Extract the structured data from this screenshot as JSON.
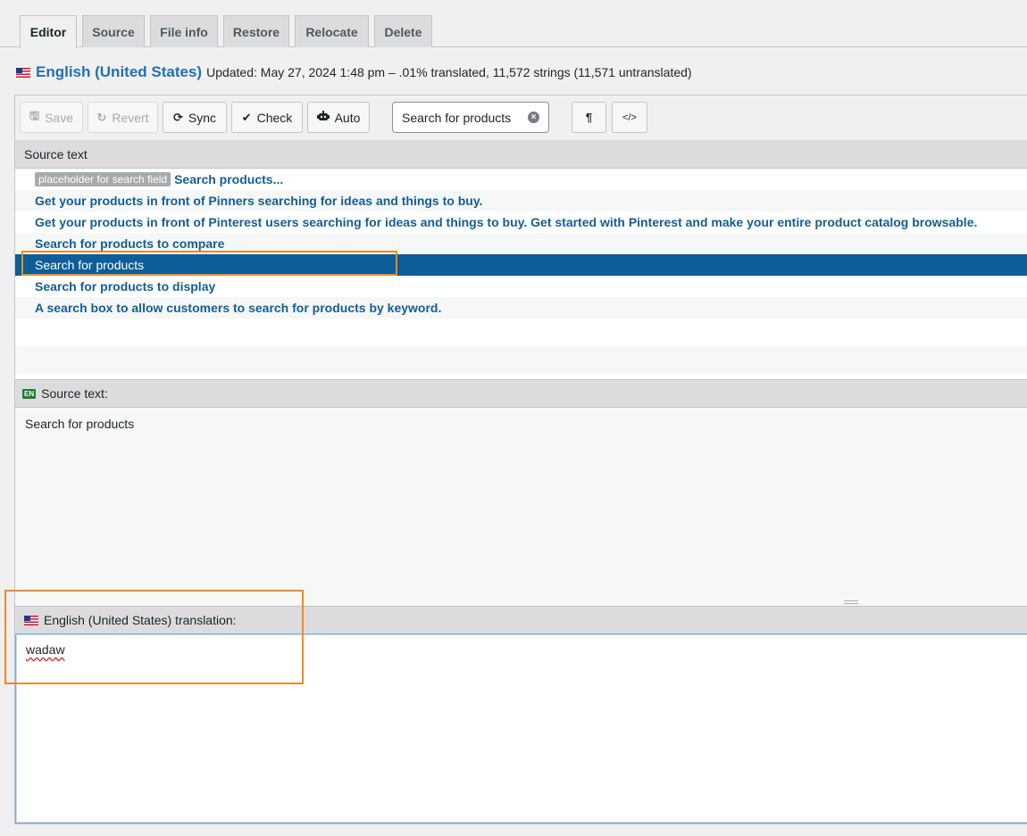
{
  "tabs": [
    {
      "label": "Editor",
      "active": true
    },
    {
      "label": "Source"
    },
    {
      "label": "File info"
    },
    {
      "label": "Restore"
    },
    {
      "label": "Relocate"
    },
    {
      "label": "Delete"
    }
  ],
  "header": {
    "flag_icon": "us-flag-icon",
    "language": "English (United States)",
    "meta": "Updated: May 27, 2024 1:48 pm – .01% translated, 11,572 strings (11,571 untranslated)"
  },
  "toolbar": {
    "save": "Save",
    "revert": "Revert",
    "sync": "Sync",
    "check": "Check",
    "auto": "Auto",
    "search_value": "Search for products",
    "pilcrow": "¶",
    "code": "</>"
  },
  "list": {
    "header": "Source text",
    "rows": [
      {
        "context": "placeholder for search field",
        "text": "Search products..."
      },
      {
        "text": "Get your products in front of Pinners searching for ideas and things to buy."
      },
      {
        "text": "Get your products in front of Pinterest users searching for ideas and things to buy. Get started with Pinterest and make your entire product catalog browsable."
      },
      {
        "text": "Search for products to compare"
      },
      {
        "text": "Search for products",
        "selected": true
      },
      {
        "text": "Search for products to display"
      },
      {
        "text": "A search box to allow customers to search for products by keyword."
      }
    ]
  },
  "source": {
    "badge": "EN",
    "label": "Source text:",
    "text": "Search for products"
  },
  "translation": {
    "label": "English (United States) translation:",
    "value": "wadaw"
  },
  "colors": {
    "accent": "#2271b1",
    "selected_row": "#0c5d98",
    "highlight": "#f08a24"
  }
}
